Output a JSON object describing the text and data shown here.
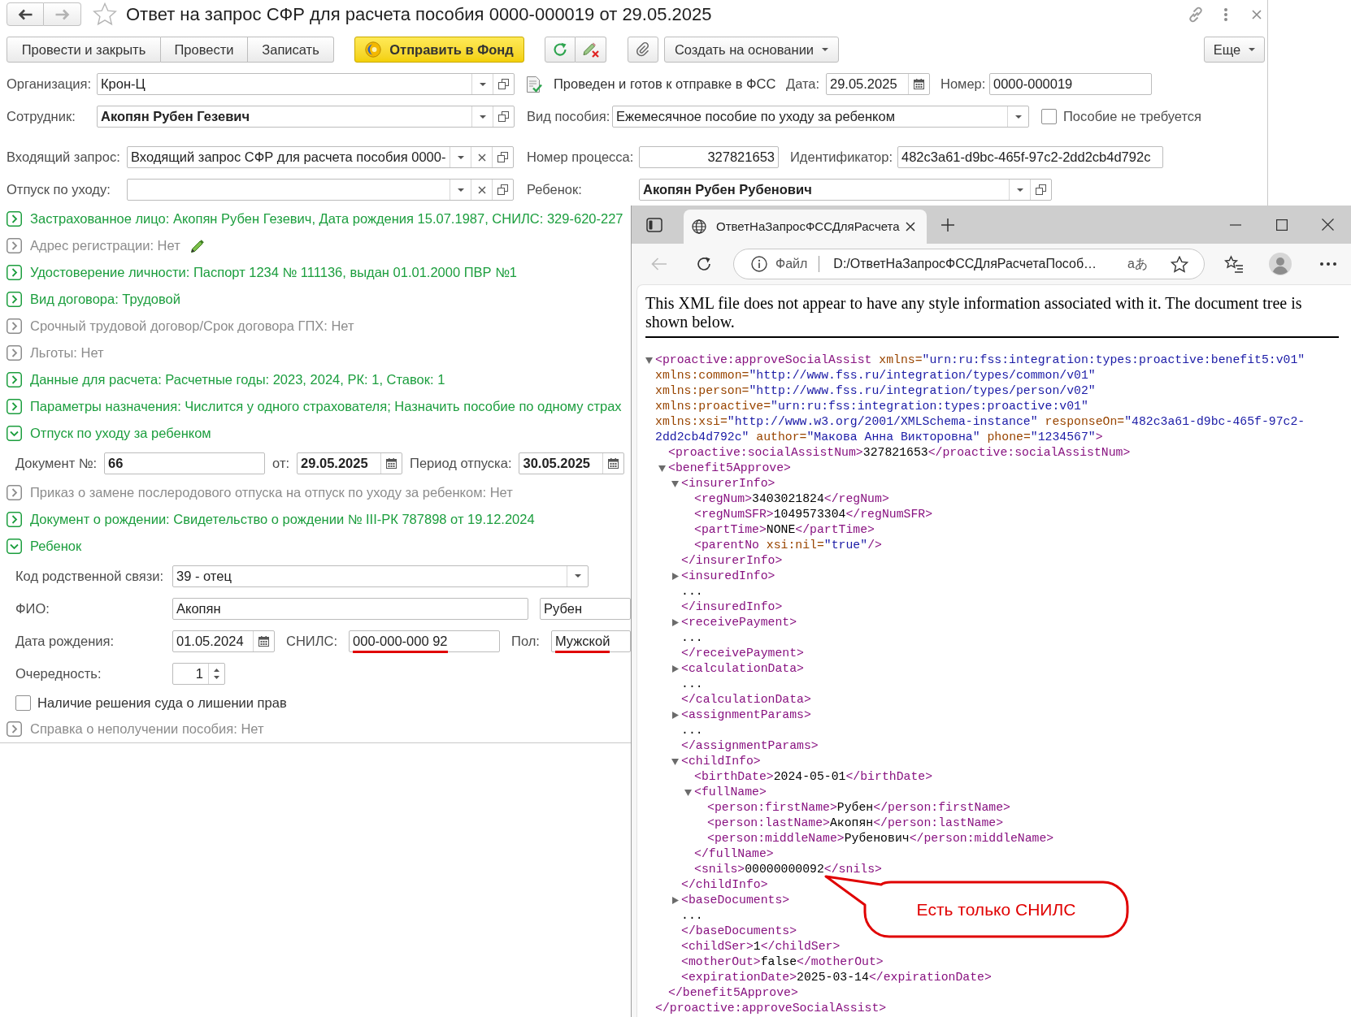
{
  "window": {
    "title": "Ответ на запрос СФР для расчета пособия 0000-000019 от 29.05.2025",
    "favorite": false,
    "back_disabled": false,
    "forward_disabled": true
  },
  "toolbar": {
    "post_group": [
      "Провести и закрыть",
      "Провести",
      "Записать"
    ],
    "send_button": "Отправить в Фонд",
    "create_based_on": "Создать на основании",
    "more": "Еще"
  },
  "header": {
    "organization": {
      "label": "Организация:",
      "value": "Крон-Ц"
    },
    "status": "Проведен и готов к отправке в ФСС",
    "date": {
      "label": "Дата:",
      "value": "29.05.2025"
    },
    "number": {
      "label": "Номер:",
      "value": "0000-000019"
    },
    "employee": {
      "label": "Сотрудник:",
      "value": "Акопян Рубен Гезевич"
    },
    "benefit_type": {
      "label": "Вид пособия:",
      "value": "Ежемесячное пособие по уходу за ребенком"
    },
    "benefit_not_required": {
      "label": "Пособие не требуется",
      "checked": false
    },
    "incoming_request": {
      "label": "Входящий запрос:",
      "value": "Входящий запрос СФР для расчета пособия 0000-"
    },
    "process_number": {
      "label": "Номер процесса:",
      "value": "327821653"
    },
    "identifier": {
      "label": "Идентификатор:",
      "value": "482c3a61-d9bc-465f-97c2-2dd2cb4d792c"
    },
    "care_leave": {
      "label": "Отпуск по уходу:"
    },
    "child": {
      "label": "Ребенок:",
      "value": "Акопян Рубен Рубенович"
    }
  },
  "sections": [
    {
      "text": "Застрахованное лицо: Акопян Рубен Гезевич, Дата рождения 15.07.1987, СНИЛС: 329-620-227",
      "color": "#1c9e3e",
      "expanded": false,
      "editable": false
    },
    {
      "text": "Адрес регистрации: Нет",
      "color": "#8c8c8c",
      "expanded": false,
      "editable": true
    },
    {
      "text": "Удостоверение личности: Паспорт 1234 № 111136, выдан 01.01.2000 ПВР №1",
      "color": "#1c9e3e",
      "expanded": false,
      "editable": false
    },
    {
      "text": "Вид договора: Трудовой",
      "color": "#1c9e3e",
      "expanded": false,
      "editable": false
    },
    {
      "text": "Срочный трудовой договор/Срок договора ГПХ: Нет",
      "color": "#8c8c8c",
      "expanded": false,
      "editable": false
    },
    {
      "text": "Льготы: Нет",
      "color": "#8c8c8c",
      "expanded": false,
      "editable": false
    },
    {
      "text": "Данные для расчета: Расчетные годы: 2023, 2024, РК: 1, Ставок: 1",
      "color": "#1c9e3e",
      "expanded": false,
      "editable": false
    },
    {
      "text": "Параметры назначения: Числится у одного страхователя; Назначить пособие по одному страх",
      "color": "#1c9e3e",
      "expanded": false,
      "editable": false
    },
    {
      "text": "Отпуск по уходу за ребенком",
      "color": "#1c9e3e",
      "expanded": true,
      "editable": false,
      "fields": [
        {
          "label": "Документ №:",
          "kind": "text",
          "value": "66",
          "bold": true,
          "underlined": false
        },
        {
          "label": "от:",
          "kind": "date",
          "value": "29.05.2025",
          "bold": true,
          "underlined": false
        },
        {
          "label": "Период отпуска:",
          "kind": "date",
          "value": "30.05.2025",
          "bold": true,
          "underlined": false
        }
      ]
    },
    {
      "text": "Приказ о замене послеродового отпуска на отпуск по уходу за ребенком: Нет",
      "color": "#8c8c8c",
      "expanded": false,
      "editable": false
    },
    {
      "text": "Документ о рождении: Свидетельство о рождении № III-РК 787898 от 19.12.2024",
      "color": "#1c9e3e",
      "expanded": false,
      "editable": false
    },
    {
      "text": "Ребенок",
      "color": "#1c9e3e",
      "expanded": true,
      "editable": false,
      "fields": [
        {
          "label": "Код родственной связи:",
          "kind": "select",
          "value": "39 - отец",
          "bold": false,
          "underlined": false
        },
        {
          "label": "ФИО:",
          "kind": "text",
          "value": "Акопян",
          "bold": false,
          "underlined": false
        },
        {
          "kind": "text",
          "value": "Рубен",
          "bold": false,
          "underlined": false
        },
        {
          "label": "Дата рождения:",
          "kind": "date",
          "value": "01.05.2024",
          "bold": false,
          "underlined": false
        },
        {
          "label": "СНИЛС:",
          "kind": "text",
          "value": "000-000-000 92",
          "bold": false,
          "underlined": true
        },
        {
          "label": "Пол:",
          "kind": "text",
          "value": "Мужской",
          "bold": false,
          "underlined": true
        },
        {
          "label": "Очередность:",
          "kind": "spinner",
          "value": "1"
        },
        {
          "label": "Наличие решения суда о лишении прав",
          "kind": "checkbox",
          "checked": false
        }
      ]
    },
    {
      "text": "Справка о неполучении пособия: Нет",
      "color": "#8c8c8c",
      "expanded": false,
      "editable": false
    }
  ],
  "browser": {
    "tab": {
      "title": "ОтветНаЗапросФССДляРасчета",
      "selected": true
    },
    "back_disabled": true,
    "address_bar": {
      "scheme": "Файл",
      "url": "D:/ОтветНаЗапросФССДляРасчетаПособ…",
      "translate": "aあ"
    },
    "notice": "This XML file does not appear to have any style information associated with it. The document tree is shown below.",
    "xml_tree": {
      "expanded": true,
      "open_lines": [
        [
          {
            "kind": "tag",
            "text": "<proactive:approveSocialAssist"
          },
          {
            "kind": "attr",
            "text": " xmlns="
          },
          {
            "kind": "value",
            "text": "\"urn:ru:fss:integration:types:proactive:benefit5:v01\""
          }
        ],
        [
          {
            "kind": "attr",
            "text": "xmlns:common="
          },
          {
            "kind": "value",
            "text": "\"http://www.fss.ru/integration/types/common/v01\""
          }
        ],
        [
          {
            "kind": "attr",
            "text": "xmlns:person="
          },
          {
            "kind": "value",
            "text": "\"http://www.fss.ru/integration/types/person/v02\""
          }
        ],
        [
          {
            "kind": "attr",
            "text": "xmlns:proactive="
          },
          {
            "kind": "value",
            "text": "\"urn:ru:fss:integration:types:proactive:v01\""
          }
        ],
        [
          {
            "kind": "attr",
            "text": "xmlns:xsi="
          },
          {
            "kind": "value",
            "text": "\"http://www.w3.org/2001/XMLSchema-instance\""
          },
          {
            "kind": "attr",
            "text": " responseOn="
          },
          {
            "kind": "value",
            "text": "\"482c3a61-d9bc-465f-97c2-"
          }
        ],
        [
          {
            "kind": "value",
            "text": "2dd2cb4d792c\""
          },
          {
            "kind": "attr",
            "text": " author="
          },
          {
            "kind": "value",
            "text": "\"Макова Анна Викторовна\""
          },
          {
            "kind": "attr",
            "text": " phone="
          },
          {
            "kind": "value",
            "text": "\"1234567\""
          },
          {
            "kind": "tag",
            "text": ">"
          }
        ]
      ],
      "children": [
        {
          "line": [
            {
              "kind": "tag",
              "text": "<proactive:socialAssistNum>"
            },
            {
              "kind": "text",
              "text": "327821653"
            },
            {
              "kind": "tag",
              "text": "</proactive:socialAssistNum>"
            }
          ]
        },
        {
          "expanded": true,
          "open": [
            {
              "kind": "tag",
              "text": "<benefit5Approve>"
            }
          ],
          "children": [
            {
              "expanded": true,
              "open": [
                {
                  "kind": "tag",
                  "text": "<insurerInfo>"
                }
              ],
              "children": [
                {
                  "line": [
                    {
                      "kind": "tag",
                      "text": "<regNum>"
                    },
                    {
                      "kind": "text",
                      "text": "3403021824"
                    },
                    {
                      "kind": "tag",
                      "text": "</regNum>"
                    }
                  ]
                },
                {
                  "line": [
                    {
                      "kind": "tag",
                      "text": "<regNumSFR>"
                    },
                    {
                      "kind": "text",
                      "text": "1049573304"
                    },
                    {
                      "kind": "tag",
                      "text": "</regNumSFR>"
                    }
                  ]
                },
                {
                  "line": [
                    {
                      "kind": "tag",
                      "text": "<partTime>"
                    },
                    {
                      "kind": "text",
                      "text": "NONE"
                    },
                    {
                      "kind": "tag",
                      "text": "</partTime>"
                    }
                  ]
                },
                {
                  "line": [
                    {
                      "kind": "tag",
                      "text": "<parentNo"
                    },
                    {
                      "kind": "attr",
                      "text": " xsi:nil="
                    },
                    {
                      "kind": "value",
                      "text": "\"true\""
                    },
                    {
                      "kind": "tag",
                      "text": "/>"
                    }
                  ]
                }
              ],
              "close": [
                {
                  "kind": "tag",
                  "text": "</insurerInfo>"
                }
              ]
            },
            {
              "expanded": false,
              "open": [
                {
                  "kind": "tag",
                  "text": "<insuredInfo>"
                }
              ],
              "ellipsis": "...",
              "close": [
                {
                  "kind": "tag",
                  "text": "</insuredInfo>"
                }
              ]
            },
            {
              "expanded": false,
              "open": [
                {
                  "kind": "tag",
                  "text": "<receivePayment>"
                }
              ],
              "ellipsis": "...",
              "close": [
                {
                  "kind": "tag",
                  "text": "</receivePayment>"
                }
              ]
            },
            {
              "expanded": false,
              "open": [
                {
                  "kind": "tag",
                  "text": "<calculationData>"
                }
              ],
              "ellipsis": "...",
              "close": [
                {
                  "kind": "tag",
                  "text": "</calculationData>"
                }
              ]
            },
            {
              "expanded": false,
              "open": [
                {
                  "kind": "tag",
                  "text": "<assignmentParams>"
                }
              ],
              "ellipsis": "...",
              "close": [
                {
                  "kind": "tag",
                  "text": "</assignmentParams>"
                }
              ]
            },
            {
              "expanded": true,
              "open": [
                {
                  "kind": "tag",
                  "text": "<childInfo>"
                }
              ],
              "children": [
                {
                  "line": [
                    {
                      "kind": "tag",
                      "text": "<birthDate>"
                    },
                    {
                      "kind": "text",
                      "text": "2024-05-01"
                    },
                    {
                      "kind": "tag",
                      "text": "</birthDate>"
                    }
                  ]
                },
                {
                  "expanded": true,
                  "open": [
                    {
                      "kind": "tag",
                      "text": "<fullName>"
                    }
                  ],
                  "children": [
                    {
                      "line": [
                        {
                          "kind": "tag",
                          "text": "<person:firstName>"
                        },
                        {
                          "kind": "text",
                          "text": "Рубен"
                        },
                        {
                          "kind": "tag",
                          "text": "</person:firstName>"
                        }
                      ]
                    },
                    {
                      "line": [
                        {
                          "kind": "tag",
                          "text": "<person:lastName>"
                        },
                        {
                          "kind": "text",
                          "text": "Акопян"
                        },
                        {
                          "kind": "tag",
                          "text": "</person:lastName>"
                        }
                      ]
                    },
                    {
                      "line": [
                        {
                          "kind": "tag",
                          "text": "<person:middleName>"
                        },
                        {
                          "kind": "text",
                          "text": "Рубенович"
                        },
                        {
                          "kind": "tag",
                          "text": "</person:middleName>"
                        }
                      ]
                    }
                  ],
                  "close": [
                    {
                      "kind": "tag",
                      "text": "</fullName>"
                    }
                  ]
                },
                {
                  "line": [
                    {
                      "kind": "tag",
                      "text": "<snils>"
                    },
                    {
                      "kind": "text",
                      "text": "00000000092"
                    },
                    {
                      "kind": "tag",
                      "text": "</snils>"
                    }
                  ]
                }
              ],
              "close": [
                {
                  "kind": "tag",
                  "text": "</childInfo>"
                }
              ]
            },
            {
              "expanded": false,
              "open": [
                {
                  "kind": "tag",
                  "text": "<baseDocuments>"
                }
              ],
              "ellipsis": "...",
              "close": [
                {
                  "kind": "tag",
                  "text": "</baseDocuments>"
                }
              ]
            },
            {
              "line": [
                {
                  "kind": "tag",
                  "text": "<childSer>"
                },
                {
                  "kind": "text",
                  "text": "1"
                },
                {
                  "kind": "tag",
                  "text": "</childSer>"
                }
              ]
            },
            {
              "line": [
                {
                  "kind": "tag",
                  "text": "<motherOut>"
                },
                {
                  "kind": "text",
                  "text": "false"
                },
                {
                  "kind": "tag",
                  "text": "</motherOut>"
                }
              ]
            },
            {
              "line": [
                {
                  "kind": "tag",
                  "text": "<expirationDate>"
                },
                {
                  "kind": "text",
                  "text": "2025-03-14"
                },
                {
                  "kind": "tag",
                  "text": "</expirationDate>"
                }
              ]
            }
          ],
          "close": [
            {
              "kind": "tag",
              "text": "</benefit5Approve>"
            }
          ]
        }
      ],
      "close": [
        {
          "kind": "tag",
          "text": "</proactive:approveSocialAssist>"
        }
      ]
    }
  },
  "callout": {
    "text": "Есть только СНИЛС"
  }
}
